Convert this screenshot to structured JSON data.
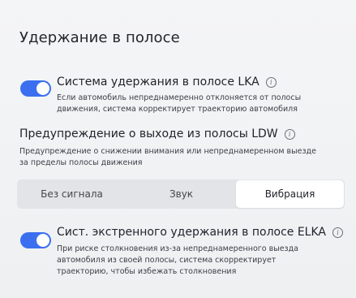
{
  "section_title": "Удержание в полосе",
  "lka": {
    "title": "Система удержания в полосе LKA",
    "enabled": true,
    "description_line1": "Если автомобиль непреднамеренно отклоняется от полосы",
    "description_line2": "движения, система корректирует траекторию автомобиля"
  },
  "ldw": {
    "title": "Предупреждение о выходе из полосы LDW",
    "description_line1": "Предупреждение о снижении внимания или непреднамеренном выезде",
    "description_line2": "за пределы полосы движения",
    "options": [
      "Без сигнала",
      "Звук",
      "Вибрация"
    ],
    "selected": "Вибрация"
  },
  "elka": {
    "title": "Сист. экстренного удержания в полосе ELKA",
    "enabled": true,
    "description_line1": "При риске столкновения из-за непреднамеренного выезда",
    "description_line2": "автомобиля из своей полосы, система скорректирует",
    "description_line3": "траекторию, чтобы избежать столкновения"
  },
  "colors": {
    "accent": "#3b6ff0",
    "background": "#f0f1f3",
    "segment_bg": "#e2e4e7",
    "segment_active": "#ffffff"
  },
  "icons": {
    "info": "info-icon"
  }
}
